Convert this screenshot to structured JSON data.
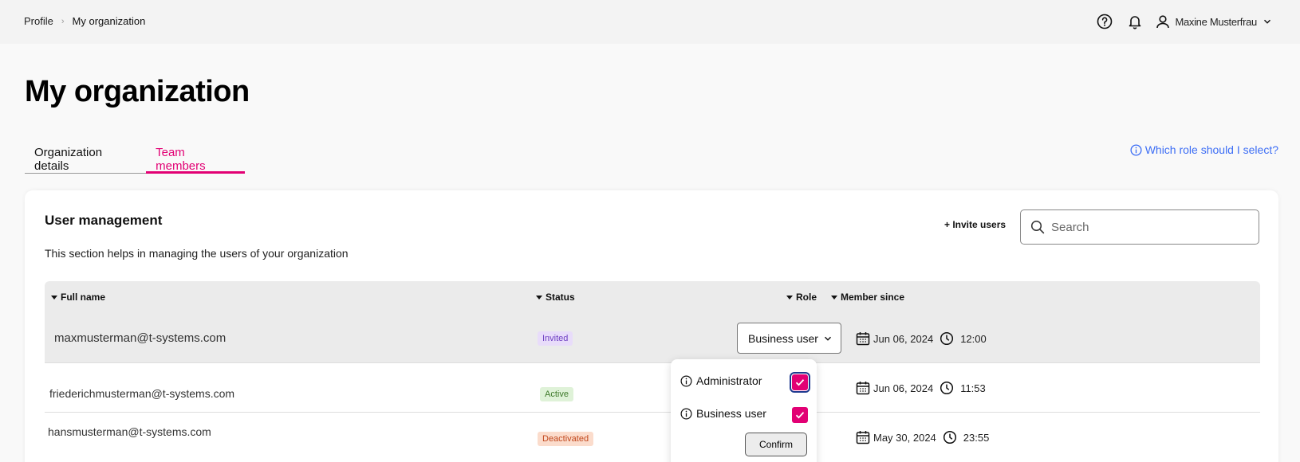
{
  "breadcrumb": {
    "items": [
      "Profile",
      "My organization"
    ],
    "separator": "›"
  },
  "header": {
    "icons": [
      "help-icon",
      "bell-icon",
      "user-icon",
      "chevron-down-icon"
    ],
    "user_name": "Maxine Musterfrau"
  },
  "page": {
    "title": "My organization",
    "tabs": [
      {
        "label": "Organization details",
        "active": false
      },
      {
        "label": "Team members",
        "active": true
      }
    ],
    "role_help_link": "Which role should I select?"
  },
  "user_management": {
    "title": "User management",
    "description": "This section helps in managing the users of your organization",
    "invite_label": "+ Invite users",
    "search_placeholder": "Search",
    "columns": [
      "Full name",
      "Status",
      "Role",
      "Member since"
    ],
    "rows": [
      {
        "email": "maxmusterman@t-systems.com",
        "status": "Invited",
        "role": "Business user",
        "date": "Jun 06, 2024",
        "time": "12:00"
      },
      {
        "email": "friederichmusterman@t-systems.com",
        "status": "Active",
        "date": "Jun 06, 2024",
        "time": "11:53"
      },
      {
        "email": "hansmusterman@t-systems.com",
        "status": "Deactivated",
        "date": "May 30, 2024",
        "time": "23:55"
      }
    ]
  },
  "role_dropdown": {
    "options": [
      {
        "label": "Administrator",
        "checked": true
      },
      {
        "label": "Business user",
        "checked": true
      }
    ],
    "confirm_label": "Confirm"
  },
  "colors": {
    "accent": "#e20074",
    "link": "#3d6ef5",
    "invited_bg": "#e8dcfa",
    "active_bg": "#dff2d8",
    "deactivated_bg": "#fbdccc"
  }
}
